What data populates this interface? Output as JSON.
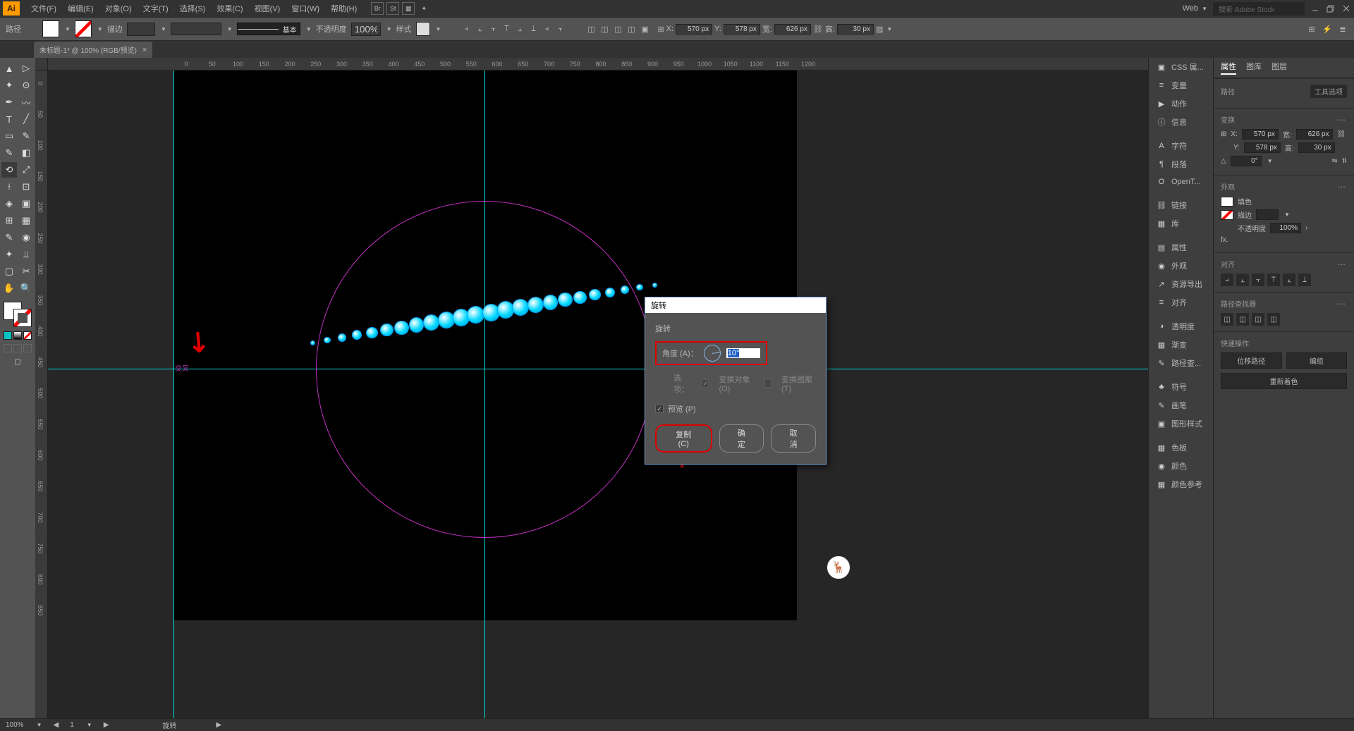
{
  "app": {
    "logo": "Ai",
    "workspace": "Web",
    "search_placeholder": "搜索 Adobe Stock"
  },
  "menu": [
    "文件(F)",
    "编辑(E)",
    "对象(O)",
    "文字(T)",
    "选择(S)",
    "效果(C)",
    "视图(V)",
    "窗口(W)",
    "帮助(H)"
  ],
  "controlbar": {
    "selection_label": "路径",
    "stroke_label": "描边",
    "stroke_weight": "",
    "brush_label": "基本",
    "opacity_label": "不透明度",
    "opacity_value": "100%",
    "style_label": "样式",
    "x_label": "X:",
    "x_value": "570 px",
    "y_label": "Y:",
    "y_value": "578 px",
    "w_label": "宽:",
    "w_value": "626 px",
    "h_label": "高:",
    "h_value": "30 px"
  },
  "tab": {
    "title": "未标题-1* @ 100% (RGB/预览)"
  },
  "ruler_h": [
    0,
    50,
    100,
    150,
    200,
    250,
    300,
    350,
    400,
    450,
    500,
    550,
    600,
    650,
    700,
    750,
    800,
    850,
    900,
    950,
    1000,
    1050,
    1100,
    1150,
    1200
  ],
  "ruler_v": [
    0,
    50,
    100,
    150,
    200,
    250,
    300,
    350,
    400,
    450,
    500,
    550,
    600,
    650,
    700,
    750,
    800,
    850
  ],
  "canvas": {
    "intersect": "交叉"
  },
  "dialog": {
    "title": "旋转",
    "section": "旋转",
    "angle_label": "角度 (A)：",
    "angle_value": "10°",
    "options_label": "选项：",
    "opt_transform_obj": "变换对象 (O)",
    "opt_transform_pattern": "变换图案 (T)",
    "preview": "预览 (P)",
    "btn_copy": "复制 (C)",
    "btn_ok": "确定",
    "btn_cancel": "取消"
  },
  "dock_items": [
    {
      "icon": "▣",
      "label": "CSS 属..."
    },
    {
      "icon": "≡",
      "label": "变量"
    },
    {
      "icon": "▶",
      "label": "动作"
    },
    {
      "icon": "ⓘ",
      "label": "信息"
    },
    {
      "icon": "A",
      "label": "字符"
    },
    {
      "icon": "¶",
      "label": "段落"
    },
    {
      "icon": "O",
      "label": "OpenT..."
    },
    {
      "icon": "⛓",
      "label": "链接"
    },
    {
      "icon": "▦",
      "label": "库"
    },
    {
      "icon": "▤",
      "label": "属性"
    },
    {
      "icon": "◉",
      "label": "外观"
    },
    {
      "icon": "↗",
      "label": "资源导出"
    },
    {
      "icon": "≡",
      "label": "对齐"
    },
    {
      "icon": "◑",
      "label": "透明度"
    },
    {
      "icon": "▦",
      "label": "渐变"
    },
    {
      "icon": "✎",
      "label": "路径查..."
    },
    {
      "icon": "♣",
      "label": "符号"
    },
    {
      "icon": "✎",
      "label": "画笔"
    },
    {
      "icon": "▣",
      "label": "图形样式"
    },
    {
      "icon": "▦",
      "label": "色板"
    },
    {
      "icon": "◉",
      "label": "颜色"
    },
    {
      "icon": "▦",
      "label": "颜色参考"
    }
  ],
  "props": {
    "tabs": [
      "属性",
      "图库",
      "图层"
    ],
    "sel_type": "路径",
    "tool_options": "工具选项",
    "transform_h": "变换",
    "x": "570 px",
    "y": "578 px",
    "w": "626 px",
    "h": "30 px",
    "angle": "0°",
    "appearance_h": "外观",
    "fill_label": "填色",
    "stroke_label": "描边",
    "opacity_label": "不透明度",
    "opacity": "100%",
    "fx_label": "fx.",
    "align_h": "对齐",
    "pathfinder_h": "路径查找器",
    "quick_h": "快速操作",
    "btn_offset": "位移路径",
    "btn_group": "编组",
    "btn_recolor": "重新着色"
  },
  "status": {
    "zoom": "100%",
    "artboard": "1",
    "tool": "旋转"
  }
}
